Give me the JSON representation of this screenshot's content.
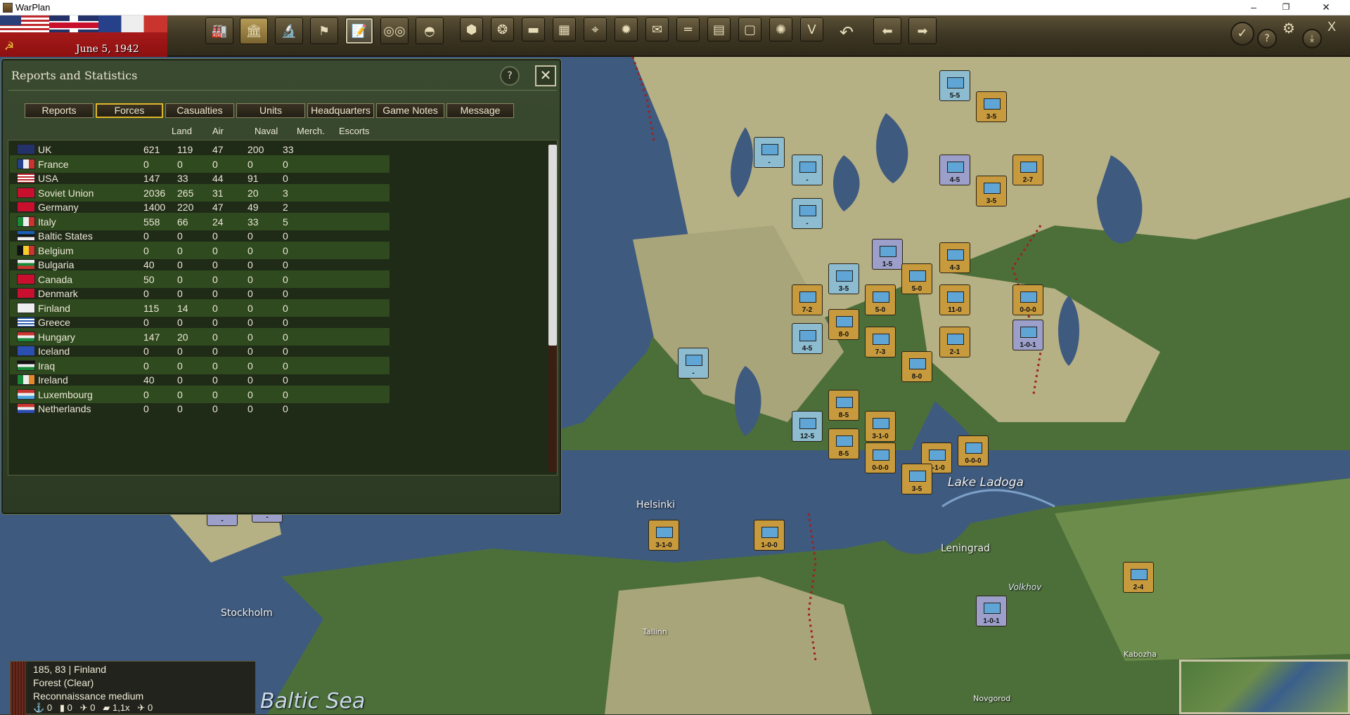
{
  "window": {
    "title": "WarPlan",
    "minimize": "–",
    "maximize": "❐",
    "close": "✕"
  },
  "header": {
    "date": "June 5, 1942"
  },
  "toolbar": {
    "left_buttons": [
      "production-icon",
      "diplomacy-icon",
      "research-icon",
      "objectives-icon",
      "reports-icon",
      "binoculars-icon",
      "helmet-icon"
    ],
    "map_buttons": [
      "hex-icon",
      "hexgrid-icon",
      "supply-icon",
      "stack-icon",
      "target-icon",
      "sun-icon",
      "envelope-icon",
      "roads-icon",
      "grid-icon",
      "frame-icon",
      "explosion-icon",
      "v-icon",
      "undo-icon",
      "back-arrow-icon",
      "forward-arrow-icon"
    ],
    "right": {
      "check": "✓",
      "help": "?",
      "settings": "⚙",
      "save": "⤓",
      "close": "X"
    }
  },
  "panel": {
    "title": "Reports and Statistics",
    "help": "?",
    "close": "✕",
    "tabs": [
      "Reports",
      "Forces",
      "Casualties",
      "Units",
      "Headquarters",
      "Game Notes",
      "Message"
    ],
    "active_tab": "Forces",
    "columns": [
      "Land",
      "Air",
      "Naval",
      "Merch.",
      "Escorts"
    ],
    "rows": [
      {
        "name": "UK",
        "land": "621",
        "air": "119",
        "naval": "47",
        "merch": "200",
        "escorts": "33",
        "flag": "uk"
      },
      {
        "name": "France",
        "land": "0",
        "air": "0",
        "naval": "0",
        "merch": "0",
        "escorts": "0",
        "flag": "fr"
      },
      {
        "name": "USA",
        "land": "147",
        "air": "33",
        "naval": "44",
        "merch": "91",
        "escorts": "0",
        "flag": "us"
      },
      {
        "name": "Soviet Union",
        "land": "2036",
        "air": "265",
        "naval": "31",
        "merch": "20",
        "escorts": "3",
        "flag": "su"
      },
      {
        "name": "Germany",
        "land": "1400",
        "air": "220",
        "naval": "47",
        "merch": "49",
        "escorts": "2",
        "flag": "de"
      },
      {
        "name": "Italy",
        "land": "558",
        "air": "66",
        "naval": "24",
        "merch": "33",
        "escorts": "5",
        "flag": "it"
      },
      {
        "name": "Baltic States",
        "land": "0",
        "air": "0",
        "naval": "0",
        "merch": "0",
        "escorts": "0",
        "flag": "ee"
      },
      {
        "name": "Belgium",
        "land": "0",
        "air": "0",
        "naval": "0",
        "merch": "0",
        "escorts": "0",
        "flag": "be"
      },
      {
        "name": "Bulgaria",
        "land": "40",
        "air": "0",
        "naval": "0",
        "merch": "0",
        "escorts": "0",
        "flag": "bg"
      },
      {
        "name": "Canada",
        "land": "50",
        "air": "0",
        "naval": "0",
        "merch": "0",
        "escorts": "0",
        "flag": "ca"
      },
      {
        "name": "Denmark",
        "land": "0",
        "air": "0",
        "naval": "0",
        "merch": "0",
        "escorts": "0",
        "flag": "dk"
      },
      {
        "name": "Finland",
        "land": "115",
        "air": "14",
        "naval": "0",
        "merch": "0",
        "escorts": "0",
        "flag": "fi"
      },
      {
        "name": "Greece",
        "land": "0",
        "air": "0",
        "naval": "0",
        "merch": "0",
        "escorts": "0",
        "flag": "gr"
      },
      {
        "name": "Hungary",
        "land": "147",
        "air": "20",
        "naval": "0",
        "merch": "0",
        "escorts": "0",
        "flag": "hu"
      },
      {
        "name": "Iceland",
        "land": "0",
        "air": "0",
        "naval": "0",
        "merch": "0",
        "escorts": "0",
        "flag": "is"
      },
      {
        "name": "Iraq",
        "land": "0",
        "air": "0",
        "naval": "0",
        "merch": "0",
        "escorts": "0",
        "flag": "iq"
      },
      {
        "name": "Ireland",
        "land": "40",
        "air": "0",
        "naval": "0",
        "merch": "0",
        "escorts": "0",
        "flag": "ie"
      },
      {
        "name": "Luxembourg",
        "land": "0",
        "air": "0",
        "naval": "0",
        "merch": "0",
        "escorts": "0",
        "flag": "lu"
      },
      {
        "name": "Netherlands",
        "land": "0",
        "air": "0",
        "naval": "0",
        "merch": "0",
        "escorts": "0",
        "flag": "nl"
      }
    ]
  },
  "hexinfo": {
    "coords": "185, 83",
    "country": "Finland",
    "terrain": "Forest (Clear)",
    "recon": "Reconnaissance medium",
    "stats": [
      "0",
      "0",
      "0",
      "1,1x",
      "0"
    ]
  },
  "map_labels": {
    "helsinki": "Helsinki",
    "stockholm": "Stockholm",
    "tallinn": "Tallinn",
    "lake_ladoga": "Lake Ladoga",
    "leningrad": "Leningrad",
    "volkhov": "Volkhov",
    "kabozha": "Kabozha",
    "novgorod": "Novgorod",
    "baltic_sea": "Baltic Sea"
  },
  "counters": [
    {
      "id": "c1",
      "val": "5-5",
      "side": "fin"
    },
    {
      "id": "c2",
      "val": "3-5",
      "side": "sov"
    },
    {
      "id": "c3",
      "val": "4-5",
      "side": "un"
    },
    {
      "id": "c4",
      "val": "2-7",
      "side": "sov"
    },
    {
      "id": "c5",
      "val": "3-5",
      "side": "sov"
    },
    {
      "id": "c6",
      "val": "-",
      "side": "fin"
    },
    {
      "id": "c7",
      "val": "-",
      "side": "fin"
    },
    {
      "id": "c8",
      "val": "-",
      "side": "fin"
    },
    {
      "id": "c9",
      "val": "1-5",
      "side": "un"
    },
    {
      "id": "c10",
      "val": "4-3",
      "side": "sov"
    },
    {
      "id": "c11",
      "val": "3-5",
      "side": "fin"
    },
    {
      "id": "c12",
      "val": "5-0",
      "side": "sov"
    },
    {
      "id": "c13",
      "val": "7-2",
      "side": "sov"
    },
    {
      "id": "c14",
      "val": "5-0",
      "side": "sov"
    },
    {
      "id": "c15",
      "val": "11-0",
      "side": "sov"
    },
    {
      "id": "c16",
      "val": "0-0-0",
      "side": "sov"
    },
    {
      "id": "c17",
      "val": "8-0",
      "side": "sov"
    },
    {
      "id": "c18",
      "val": "4-5",
      "side": "fin"
    },
    {
      "id": "c19",
      "val": "7-3",
      "side": "sov"
    },
    {
      "id": "c20",
      "val": "2-1",
      "side": "sov"
    },
    {
      "id": "c21",
      "val": "3-5",
      "side": "sov"
    },
    {
      "id": "c22",
      "val": "8-0",
      "side": "sov"
    },
    {
      "id": "c23",
      "val": "-",
      "side": "fin"
    },
    {
      "id": "c24",
      "val": "8-5",
      "side": "sov"
    },
    {
      "id": "c25",
      "val": "12-5",
      "side": "fin"
    },
    {
      "id": "c26",
      "val": "3-1-0",
      "side": "ger"
    },
    {
      "id": "c27",
      "val": "8-5",
      "side": "sov"
    },
    {
      "id": "c28",
      "val": "0-0-0",
      "side": "sov"
    },
    {
      "id": "c29",
      "val": "3-1-0",
      "side": "ger"
    },
    {
      "id": "c30",
      "val": "0-0-0",
      "side": "sov"
    },
    {
      "id": "c31",
      "val": "3-5",
      "side": "sov"
    },
    {
      "id": "c32",
      "val": "-",
      "side": "un"
    },
    {
      "id": "c33",
      "val": "-",
      "side": "un"
    },
    {
      "id": "c34",
      "val": "-",
      "side": "un"
    },
    {
      "id": "c35",
      "val": "3-1-0",
      "side": "ger"
    },
    {
      "id": "c36",
      "val": "1-0-0",
      "side": "sov"
    },
    {
      "id": "c37",
      "val": "2-4",
      "side": "sov"
    },
    {
      "id": "c38",
      "val": "1-0-1",
      "side": "un"
    },
    {
      "id": "c39",
      "val": "1-0-1",
      "side": "un"
    }
  ],
  "colors": {
    "panel_bg": "#2c3a24",
    "active_tab_border": "#e0b52a",
    "water": "#3e5a7f",
    "steppe": "#b6b085",
    "forest": "#4c6f3a"
  }
}
